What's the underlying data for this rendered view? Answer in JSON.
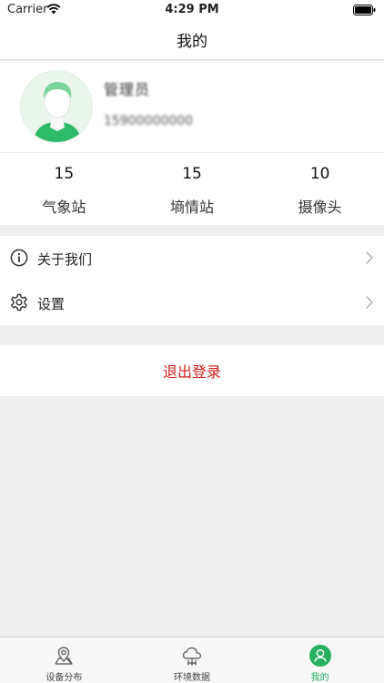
{
  "status_bar": {
    "carrier": "Carrier",
    "time": "4:29 PM"
  },
  "nav": {
    "title": "我的"
  },
  "profile": {
    "name": "管理员",
    "phone": "15900000000"
  },
  "stats": [
    {
      "value": "15",
      "label": "气象站"
    },
    {
      "value": "15",
      "label": "墒情站"
    },
    {
      "value": "10",
      "label": "摄像头"
    }
  ],
  "menu": [
    {
      "label": "关于我们",
      "icon": "info-icon"
    },
    {
      "label": "设置",
      "icon": "gear-icon"
    }
  ],
  "logout": {
    "label": "退出登录"
  },
  "tabs": [
    {
      "label": "设备分布",
      "icon": "map-pin-icon",
      "active": false
    },
    {
      "label": "环境数据",
      "icon": "cloud-data-icon",
      "active": false
    },
    {
      "label": "我的",
      "icon": "user-icon",
      "active": true
    }
  ],
  "colors": {
    "accent": "#27b060",
    "danger": "#d0201c",
    "background": "#efefef"
  }
}
